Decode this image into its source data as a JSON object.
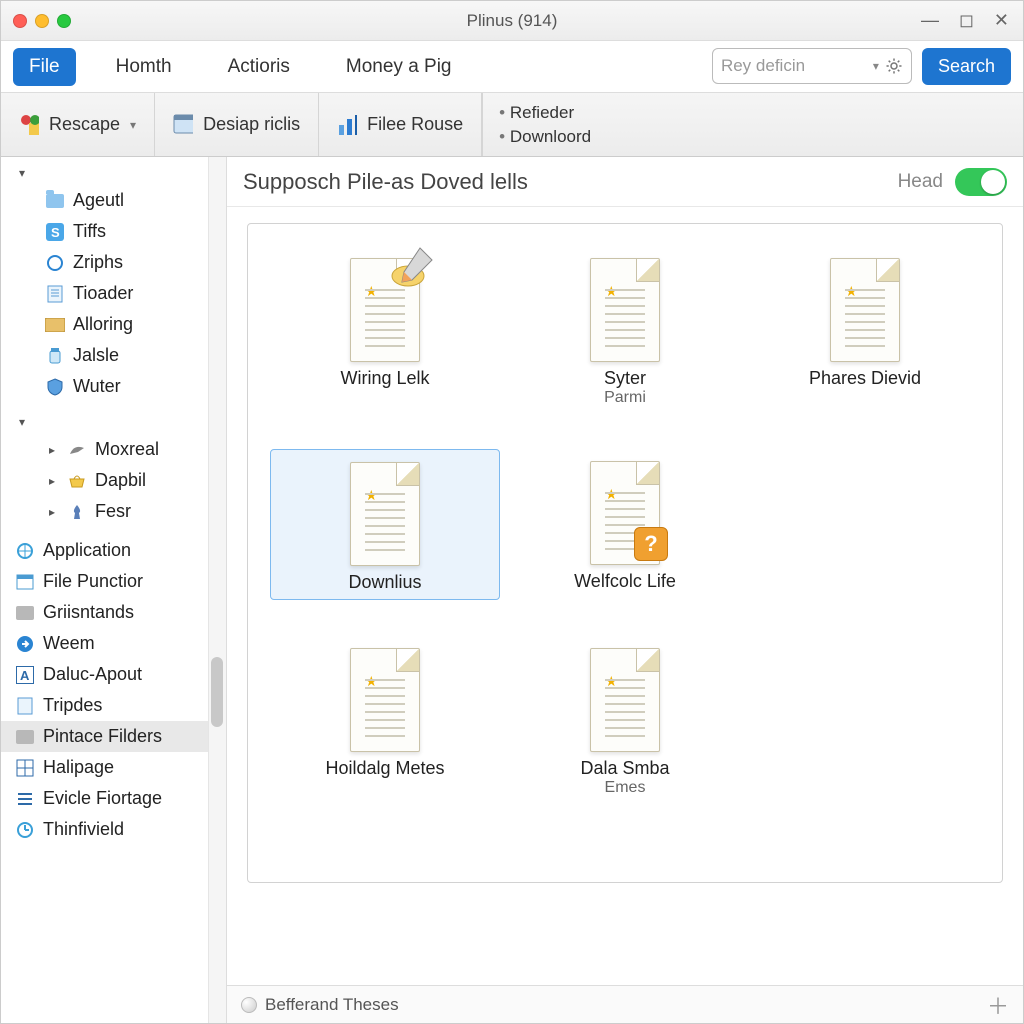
{
  "window": {
    "title": "Plinus (914)"
  },
  "menubar": {
    "items": [
      "File",
      "Homth",
      "Actioris",
      "Money a Pig"
    ],
    "active_index": 0,
    "search_placeholder": "Rey deficin",
    "search_button": "Search"
  },
  "toolbar": {
    "buttons": [
      {
        "label": "Rescape",
        "has_caret": true
      },
      {
        "label": "Desiap riclis",
        "has_caret": false
      },
      {
        "label": "Filee Rouse",
        "has_caret": false
      }
    ],
    "sidepanel": [
      "Refieder",
      "Downloord"
    ]
  },
  "sidebar": {
    "group1": {
      "items": [
        "Ageutl",
        "Tiffs",
        "Zriphs",
        "Tioader",
        "Alloring",
        "Jalsle",
        "Wuter"
      ]
    },
    "group2": {
      "items": [
        "Moxreal",
        "Dapbil",
        "Fesr"
      ]
    },
    "group3": {
      "items": [
        "Application",
        "File Punctior",
        "Griisntands",
        "Weem",
        "Daluc-Apout",
        "Tripdes",
        "Pintace Filders",
        "Halipage",
        "Evicle Fiortage",
        "Thinfivield"
      ],
      "selected_index": 6
    }
  },
  "content": {
    "header_title": "Supposch Pile-as Doved lells",
    "toggle_label": "Head",
    "toggle_on": true,
    "files": [
      {
        "name": "Wiring Lelk",
        "sub": "",
        "badge": "pencil"
      },
      {
        "name": "Syter",
        "sub": "Parmi",
        "badge": ""
      },
      {
        "name": "Phares Dievid",
        "sub": "",
        "badge": ""
      },
      {
        "name": "Downlius",
        "sub": "",
        "badge": "",
        "selected": true
      },
      {
        "name": "Welfcolc Life",
        "sub": "",
        "badge": "question"
      },
      {
        "name": "Hoildalg Metes",
        "sub": "",
        "badge": ""
      },
      {
        "name": "Dala Smba",
        "sub": "Emes",
        "badge": ""
      }
    ]
  },
  "footer": {
    "text": "Befferand Theses"
  }
}
